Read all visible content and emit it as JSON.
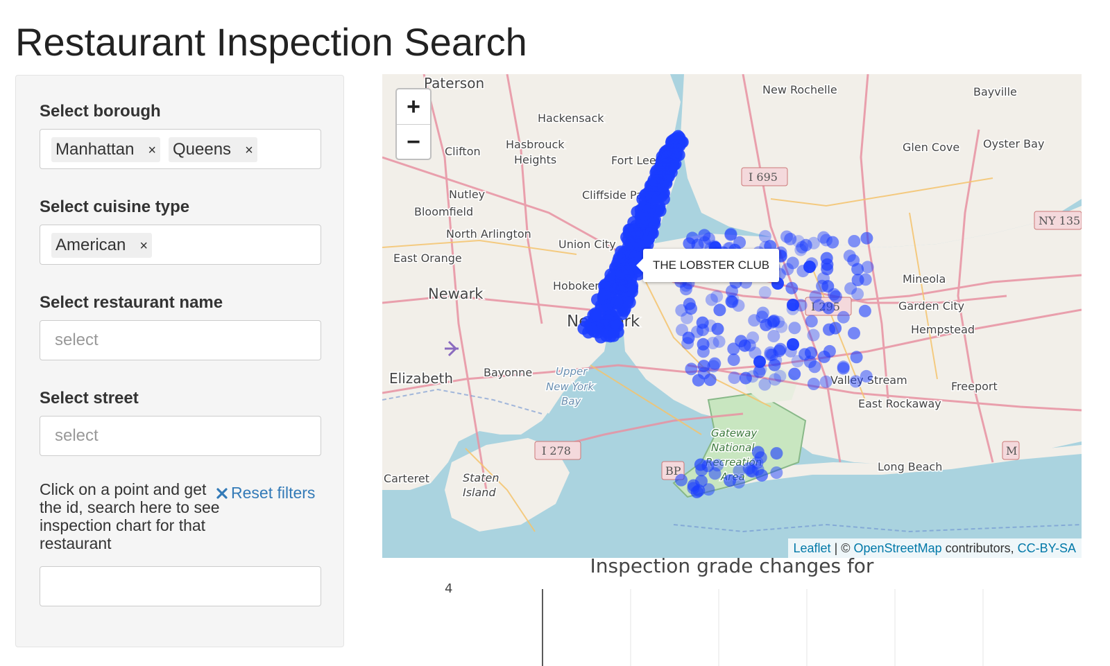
{
  "page": {
    "title": "Restaurant Inspection Search"
  },
  "sidebar": {
    "borough": {
      "label": "Select borough",
      "selected": [
        "Manhattan",
        "Queens"
      ]
    },
    "cuisine": {
      "label": "Select cuisine type",
      "selected": [
        "American"
      ]
    },
    "restaurant_name": {
      "label": "Select restaurant name",
      "placeholder": "select"
    },
    "street": {
      "label": "Select street",
      "placeholder": "select"
    },
    "hint": "Click on a point and get the id, search here to see inspection chart for that restaurant",
    "reset_label": "Reset filters",
    "id_input_value": ""
  },
  "map": {
    "zoom_in": "+",
    "zoom_out": "−",
    "tooltip": "THE LOBSTER CLUB",
    "attribution": {
      "leaflet": "Leaflet",
      "sep1": " | © ",
      "osm": "OpenStreetMap",
      "mid": " contributors, ",
      "license": "CC-BY-SA"
    },
    "place_labels": [
      "Paterson",
      "New Rochelle",
      "Bayville",
      "Hackensack",
      "Hasbrouck Heights",
      "Clifton",
      "Fort Lee",
      "Glen Cove",
      "Oyster Bay",
      "Nutley",
      "Cliffside Park",
      "Bloomfield",
      "North Arlington",
      "Union City",
      "East Orange",
      "Hoboken",
      "Newark",
      "New York",
      "Mineola",
      "Garden City",
      "Hempstead",
      "Elizabeth",
      "Bayonne",
      "Upper New York Bay",
      "Valley Stream",
      "Freeport",
      "East Rockaway",
      "Staten Island",
      "Carteret",
      "Gateway National Recreation Area",
      "Long Beach"
    ],
    "route_shields": [
      "I 695",
      "I 295",
      "I 278",
      "BP",
      "NY 135",
      "M"
    ],
    "marker_color": "#1a3cff",
    "water_color": "#aad3df",
    "land_color": "#f2efe9"
  },
  "chart": {
    "title": "Inspection grade changes for",
    "y_tick_label": "4"
  }
}
